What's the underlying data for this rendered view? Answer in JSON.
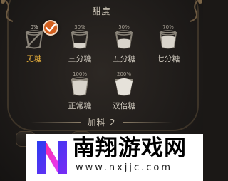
{
  "sweetness": {
    "title": "甜度",
    "options": [
      {
        "percent": "0%",
        "label": "无糖",
        "selected": true
      },
      {
        "percent": "30%",
        "label": "三分糖",
        "selected": false
      },
      {
        "percent": "50%",
        "label": "五分糖",
        "selected": false
      },
      {
        "percent": "70%",
        "label": "七分糖",
        "selected": false
      },
      {
        "percent": "100%",
        "label": "正常糖",
        "selected": false
      },
      {
        "percent": "200%",
        "label": "双倍糖",
        "selected": false
      }
    ]
  },
  "toppings": {
    "title": "加料-2"
  },
  "watermark": {
    "title": "南翔游戏网",
    "url": "www.nxjjc.com"
  },
  "colors": {
    "accent": "#f2b73d",
    "check": "#d35f1e",
    "panel": "#1e1b19"
  }
}
